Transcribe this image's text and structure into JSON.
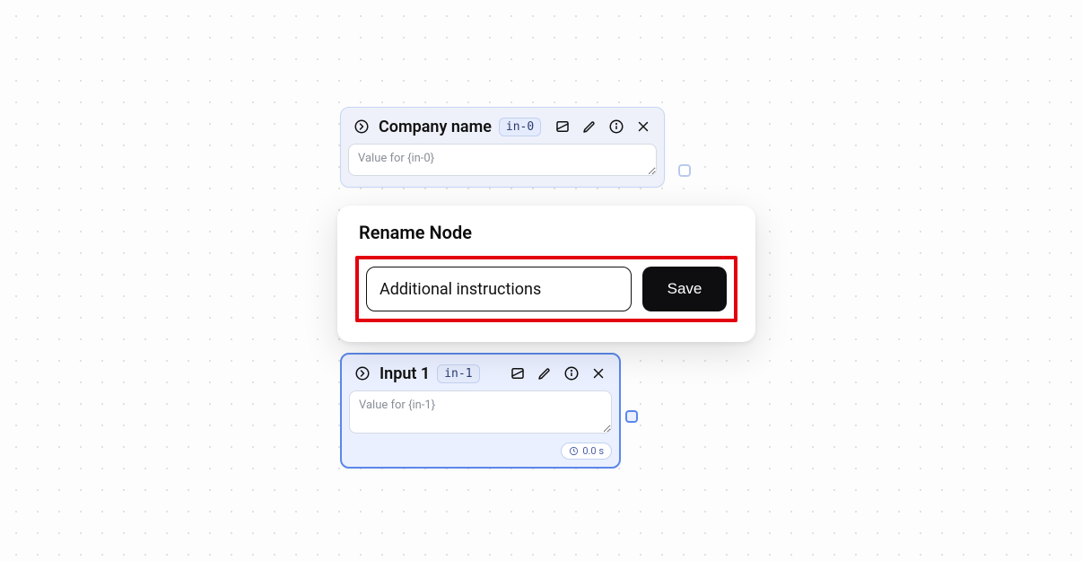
{
  "node1": {
    "title": "Company name",
    "tag": "in-0",
    "textarea_placeholder": "Value for {in-0}"
  },
  "handle1": {},
  "dialog": {
    "title": "Rename Node",
    "input_value": "Additional instructions",
    "save_label": "Save"
  },
  "node2": {
    "title": "Input 1",
    "tag": "in-1",
    "textarea_placeholder": "Value for {in-1}",
    "time_label": "0.0 s"
  },
  "handle2": {}
}
